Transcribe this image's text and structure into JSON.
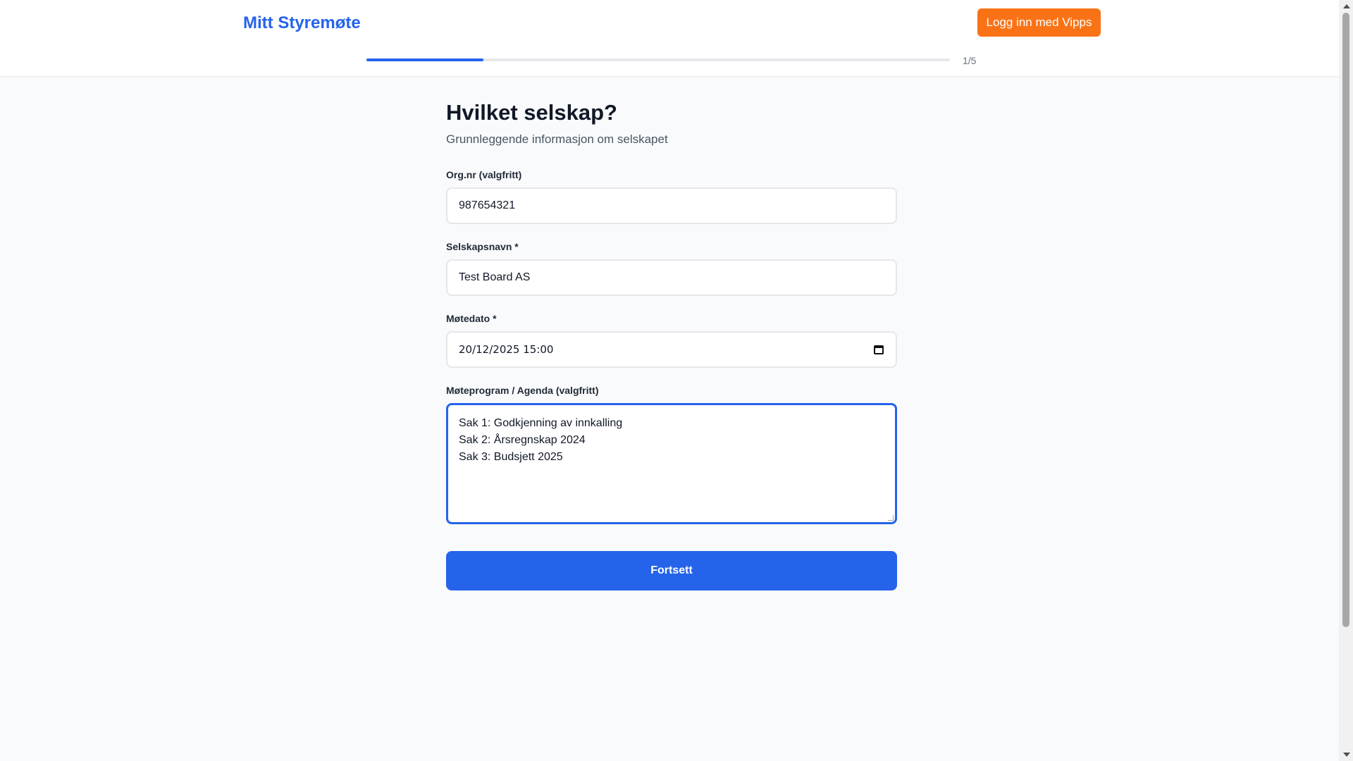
{
  "header": {
    "brand": "Mitt Styremøte",
    "login_button": "Logg inn med Vipps"
  },
  "progress": {
    "label": "1/5",
    "fraction": 0.2
  },
  "form": {
    "title": "Hvilket selskap?",
    "subtitle": "Grunnleggende informasjon om selskapet",
    "org_nr": {
      "label": "Org.nr (valgfritt)",
      "value": "987654321"
    },
    "company_name": {
      "label": "Selskapsnavn *",
      "value": "Test Board AS"
    },
    "meeting_date": {
      "label": "Møtedato *",
      "value": "20/12/2025  15:00"
    },
    "agenda": {
      "label": "Møteprogram / Agenda (valgfritt)",
      "lines": [
        "Sak 1: Godkjenning av innkalling",
        "Sak 2: Årsregnskap 2024",
        "Sak 3: Budsjett 2025"
      ]
    },
    "submit_button": "Fortsett"
  },
  "colors": {
    "primary": "#2563eb",
    "vipps": "#f97316",
    "background": "#f9fafb"
  }
}
